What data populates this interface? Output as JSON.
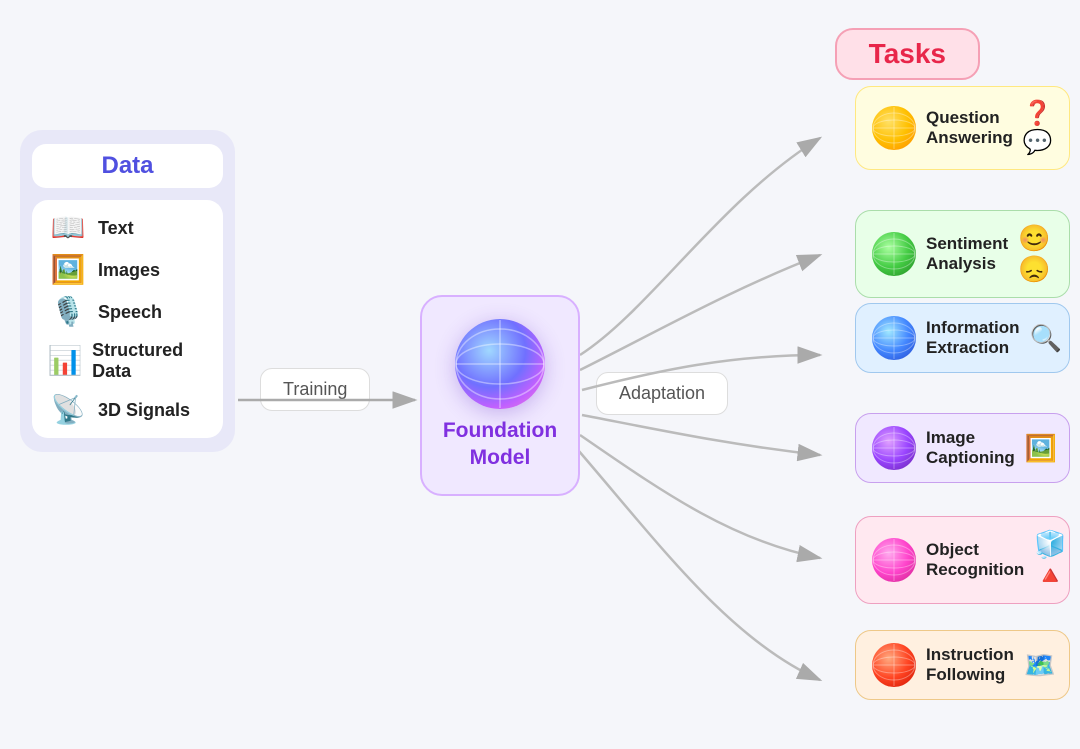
{
  "tasks_title": "Tasks",
  "data_title": "Data",
  "training_label": "Training",
  "adaptation_label": "Adaptation",
  "foundation_model_label": "Foundation\nModel",
  "data_items": [
    {
      "name": "Text",
      "icon": "📖"
    },
    {
      "name": "Images",
      "icon": "🖼️"
    },
    {
      "name": "Speech",
      "icon": "🎤"
    },
    {
      "name": "Structured Data",
      "icon": "📊"
    },
    {
      "name": "3D Signals",
      "icon": "📡"
    }
  ],
  "tasks": [
    {
      "id": "qa",
      "label": "Question Answering",
      "emoji": "❓💬",
      "globe_class": "globe-yellow"
    },
    {
      "id": "sa",
      "label": "Sentiment Analysis",
      "emoji": "😊",
      "globe_class": "globe-green"
    },
    {
      "id": "ie",
      "label": "Information Extraction",
      "emoji": "🔍",
      "globe_class": "globe-blue"
    },
    {
      "id": "ic",
      "label": "Image Captioning",
      "emoji": "🖼️",
      "globe_class": "globe-purple"
    },
    {
      "id": "or",
      "label": "Object Recognition",
      "emoji": "🧊",
      "globe_class": "globe-pink"
    },
    {
      "id": "if",
      "label": "Instruction Following",
      "emoji": "🗺️",
      "globe_class": "globe-red"
    }
  ],
  "colors": {
    "tasks_text": "#e8264a",
    "tasks_bg": "#ffe0e8",
    "data_text": "#5050e0",
    "foundation_text": "#8030e0"
  }
}
